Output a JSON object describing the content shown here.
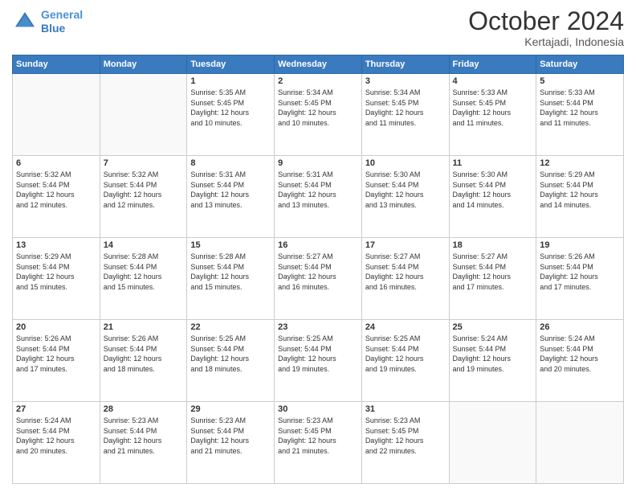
{
  "header": {
    "logo_line1": "General",
    "logo_line2": "Blue",
    "month": "October 2024",
    "location": "Kertajadi, Indonesia"
  },
  "days_of_week": [
    "Sunday",
    "Monday",
    "Tuesday",
    "Wednesday",
    "Thursday",
    "Friday",
    "Saturday"
  ],
  "weeks": [
    [
      {
        "day": "",
        "info": ""
      },
      {
        "day": "",
        "info": ""
      },
      {
        "day": "1",
        "info": "Sunrise: 5:35 AM\nSunset: 5:45 PM\nDaylight: 12 hours\nand 10 minutes."
      },
      {
        "day": "2",
        "info": "Sunrise: 5:34 AM\nSunset: 5:45 PM\nDaylight: 12 hours\nand 10 minutes."
      },
      {
        "day": "3",
        "info": "Sunrise: 5:34 AM\nSunset: 5:45 PM\nDaylight: 12 hours\nand 11 minutes."
      },
      {
        "day": "4",
        "info": "Sunrise: 5:33 AM\nSunset: 5:45 PM\nDaylight: 12 hours\nand 11 minutes."
      },
      {
        "day": "5",
        "info": "Sunrise: 5:33 AM\nSunset: 5:44 PM\nDaylight: 12 hours\nand 11 minutes."
      }
    ],
    [
      {
        "day": "6",
        "info": "Sunrise: 5:32 AM\nSunset: 5:44 PM\nDaylight: 12 hours\nand 12 minutes."
      },
      {
        "day": "7",
        "info": "Sunrise: 5:32 AM\nSunset: 5:44 PM\nDaylight: 12 hours\nand 12 minutes."
      },
      {
        "day": "8",
        "info": "Sunrise: 5:31 AM\nSunset: 5:44 PM\nDaylight: 12 hours\nand 13 minutes."
      },
      {
        "day": "9",
        "info": "Sunrise: 5:31 AM\nSunset: 5:44 PM\nDaylight: 12 hours\nand 13 minutes."
      },
      {
        "day": "10",
        "info": "Sunrise: 5:30 AM\nSunset: 5:44 PM\nDaylight: 12 hours\nand 13 minutes."
      },
      {
        "day": "11",
        "info": "Sunrise: 5:30 AM\nSunset: 5:44 PM\nDaylight: 12 hours\nand 14 minutes."
      },
      {
        "day": "12",
        "info": "Sunrise: 5:29 AM\nSunset: 5:44 PM\nDaylight: 12 hours\nand 14 minutes."
      }
    ],
    [
      {
        "day": "13",
        "info": "Sunrise: 5:29 AM\nSunset: 5:44 PM\nDaylight: 12 hours\nand 15 minutes."
      },
      {
        "day": "14",
        "info": "Sunrise: 5:28 AM\nSunset: 5:44 PM\nDaylight: 12 hours\nand 15 minutes."
      },
      {
        "day": "15",
        "info": "Sunrise: 5:28 AM\nSunset: 5:44 PM\nDaylight: 12 hours\nand 15 minutes."
      },
      {
        "day": "16",
        "info": "Sunrise: 5:27 AM\nSunset: 5:44 PM\nDaylight: 12 hours\nand 16 minutes."
      },
      {
        "day": "17",
        "info": "Sunrise: 5:27 AM\nSunset: 5:44 PM\nDaylight: 12 hours\nand 16 minutes."
      },
      {
        "day": "18",
        "info": "Sunrise: 5:27 AM\nSunset: 5:44 PM\nDaylight: 12 hours\nand 17 minutes."
      },
      {
        "day": "19",
        "info": "Sunrise: 5:26 AM\nSunset: 5:44 PM\nDaylight: 12 hours\nand 17 minutes."
      }
    ],
    [
      {
        "day": "20",
        "info": "Sunrise: 5:26 AM\nSunset: 5:44 PM\nDaylight: 12 hours\nand 17 minutes."
      },
      {
        "day": "21",
        "info": "Sunrise: 5:26 AM\nSunset: 5:44 PM\nDaylight: 12 hours\nand 18 minutes."
      },
      {
        "day": "22",
        "info": "Sunrise: 5:25 AM\nSunset: 5:44 PM\nDaylight: 12 hours\nand 18 minutes."
      },
      {
        "day": "23",
        "info": "Sunrise: 5:25 AM\nSunset: 5:44 PM\nDaylight: 12 hours\nand 19 minutes."
      },
      {
        "day": "24",
        "info": "Sunrise: 5:25 AM\nSunset: 5:44 PM\nDaylight: 12 hours\nand 19 minutes."
      },
      {
        "day": "25",
        "info": "Sunrise: 5:24 AM\nSunset: 5:44 PM\nDaylight: 12 hours\nand 19 minutes."
      },
      {
        "day": "26",
        "info": "Sunrise: 5:24 AM\nSunset: 5:44 PM\nDaylight: 12 hours\nand 20 minutes."
      }
    ],
    [
      {
        "day": "27",
        "info": "Sunrise: 5:24 AM\nSunset: 5:44 PM\nDaylight: 12 hours\nand 20 minutes."
      },
      {
        "day": "28",
        "info": "Sunrise: 5:23 AM\nSunset: 5:44 PM\nDaylight: 12 hours\nand 21 minutes."
      },
      {
        "day": "29",
        "info": "Sunrise: 5:23 AM\nSunset: 5:44 PM\nDaylight: 12 hours\nand 21 minutes."
      },
      {
        "day": "30",
        "info": "Sunrise: 5:23 AM\nSunset: 5:45 PM\nDaylight: 12 hours\nand 21 minutes."
      },
      {
        "day": "31",
        "info": "Sunrise: 5:23 AM\nSunset: 5:45 PM\nDaylight: 12 hours\nand 22 minutes."
      },
      {
        "day": "",
        "info": ""
      },
      {
        "day": "",
        "info": ""
      }
    ]
  ]
}
